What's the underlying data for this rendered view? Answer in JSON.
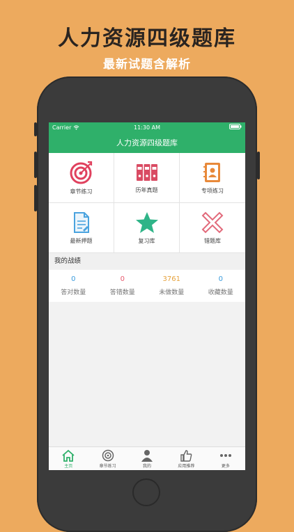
{
  "promo": {
    "title": "人力资源四级题库",
    "subtitle": "最新试题含解析"
  },
  "statusbar": {
    "carrier": "Carrier",
    "time": "11:30 AM"
  },
  "app": {
    "title": "人力资源四级题库"
  },
  "grid": {
    "items": [
      {
        "label": "章节练习",
        "icon": "target-icon"
      },
      {
        "label": "历年真题",
        "icon": "binders-icon"
      },
      {
        "label": "专项练习",
        "icon": "contact-book-icon"
      },
      {
        "label": "最新押题",
        "icon": "document-icon"
      },
      {
        "label": "复习库",
        "icon": "star-icon"
      },
      {
        "label": "错题库",
        "icon": "x-mark-icon"
      }
    ]
  },
  "stats": {
    "section_title": "我的战绩",
    "items": [
      {
        "value": "0",
        "label": "答对数量",
        "color": "#3a9bdc"
      },
      {
        "value": "0",
        "label": "答错数量",
        "color": "#e85a6e"
      },
      {
        "value": "3761",
        "label": "未做数量",
        "color": "#e6a23c"
      },
      {
        "value": "0",
        "label": "收藏数量",
        "color": "#3a9bdc"
      }
    ]
  },
  "tabbar": {
    "items": [
      {
        "label": "主页",
        "icon": "home-icon",
        "active": true
      },
      {
        "label": "章节练习",
        "icon": "target-icon",
        "active": false
      },
      {
        "label": "我的",
        "icon": "user-icon",
        "active": false
      },
      {
        "label": "应用推荐",
        "icon": "thumbs-up-icon",
        "active": false
      },
      {
        "label": "更多",
        "icon": "more-icon",
        "active": false
      }
    ]
  },
  "colors": {
    "background": "#EDAA5E",
    "brand_green": "#2fb06a",
    "phone_body": "#3b3b3b"
  }
}
